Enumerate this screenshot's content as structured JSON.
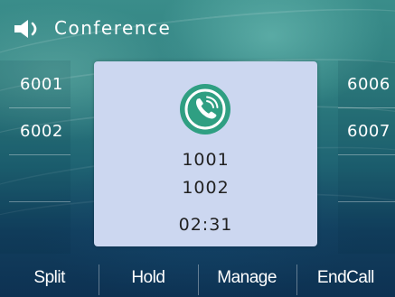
{
  "header": {
    "title": "Conference",
    "icon": "speaker-icon"
  },
  "line_keys": {
    "left": [
      {
        "label": "6001"
      },
      {
        "label": "6002"
      },
      {
        "label": ""
      },
      {
        "label": ""
      }
    ],
    "right": [
      {
        "label": "6006"
      },
      {
        "label": "6007"
      },
      {
        "label": ""
      },
      {
        "label": ""
      }
    ]
  },
  "call": {
    "icon": "phone-handset-icon",
    "participants": [
      "1001",
      "1002"
    ],
    "timer": "02:31"
  },
  "softkeys": [
    {
      "label": "Split"
    },
    {
      "label": "Hold"
    },
    {
      "label": "Manage"
    },
    {
      "label": "EndCall"
    }
  ],
  "colors": {
    "dialog_background": "#ccd7f0",
    "phone_icon_green": "#2f9f82",
    "text_light": "#ffffff",
    "text_dark": "#222222"
  }
}
